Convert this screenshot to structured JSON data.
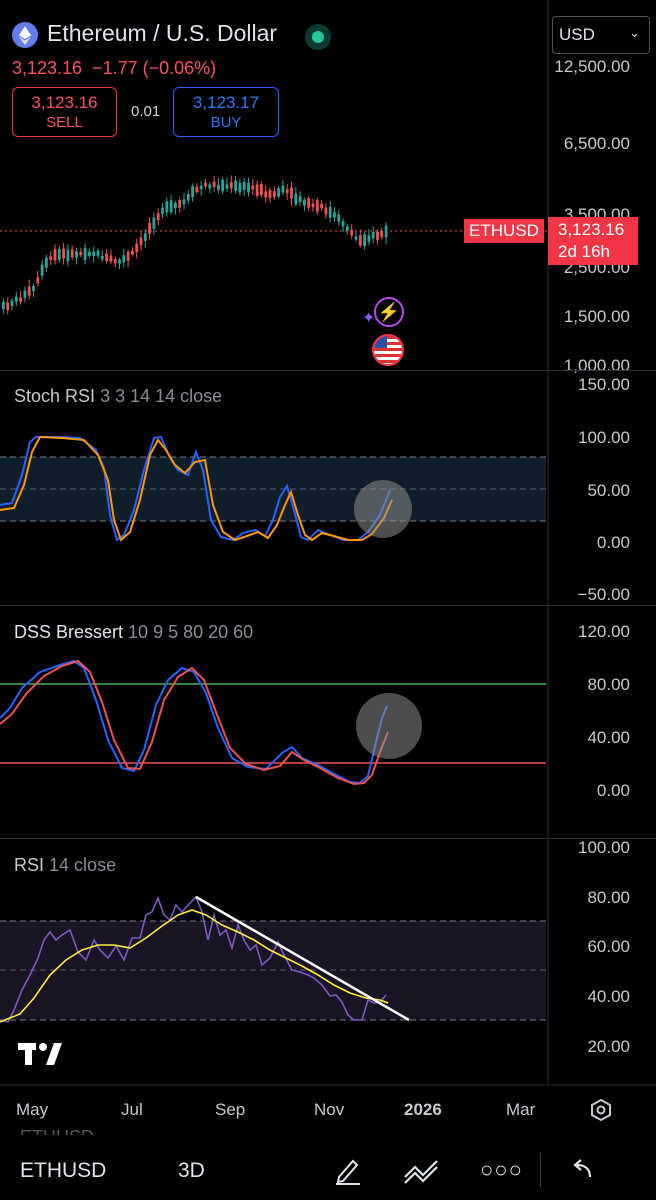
{
  "header": {
    "symbol_title": "Ethereum / U.S. Dollar",
    "price_line": "3,123.16  −1.77 (−0.06%)",
    "sell_price": "3,123.16",
    "sell_label": "SELL",
    "spread": "0.01",
    "buy_price": "3,123.17",
    "buy_label": "BUY",
    "currency": "USD"
  },
  "price_axis": [
    "12,500.00",
    "6,500.00",
    "3,500.00",
    "2,500.00",
    "1,500.00",
    "1,000.00"
  ],
  "price_tag": {
    "symbol": "ETHUSD",
    "price": "3,123.16",
    "countdown": "2d 16h"
  },
  "stoch_rsi": {
    "title": "Stoch RSI",
    "params": "3 3 14 14 close",
    "axis": [
      "150.00",
      "100.00",
      "50.00",
      "0.00",
      "−50.00"
    ]
  },
  "dss": {
    "title": "DSS Bressert",
    "params": "10 9 5 80 20 60",
    "axis": [
      "120.00",
      "80.00",
      "40.00",
      "0.00"
    ]
  },
  "rsi": {
    "title": "RSI",
    "params": "14 close",
    "axis": [
      "100.00",
      "80.00",
      "60.00",
      "40.00",
      "20.00"
    ]
  },
  "time_axis": [
    "May",
    "Jul",
    "Sep",
    "Nov",
    "2026",
    "Mar"
  ],
  "bottom": {
    "symbol": "ETHUSD",
    "interval": "3D",
    "partial_top": "ETHUSD"
  },
  "colors": {
    "up": "#26a69a",
    "down": "#ef5350",
    "blue": "#2962ff",
    "orange": "#ff9800",
    "rsi_line": "#7e57c2",
    "rsi_ma": "#ffeb3b",
    "green_level": "#4caf50"
  }
}
